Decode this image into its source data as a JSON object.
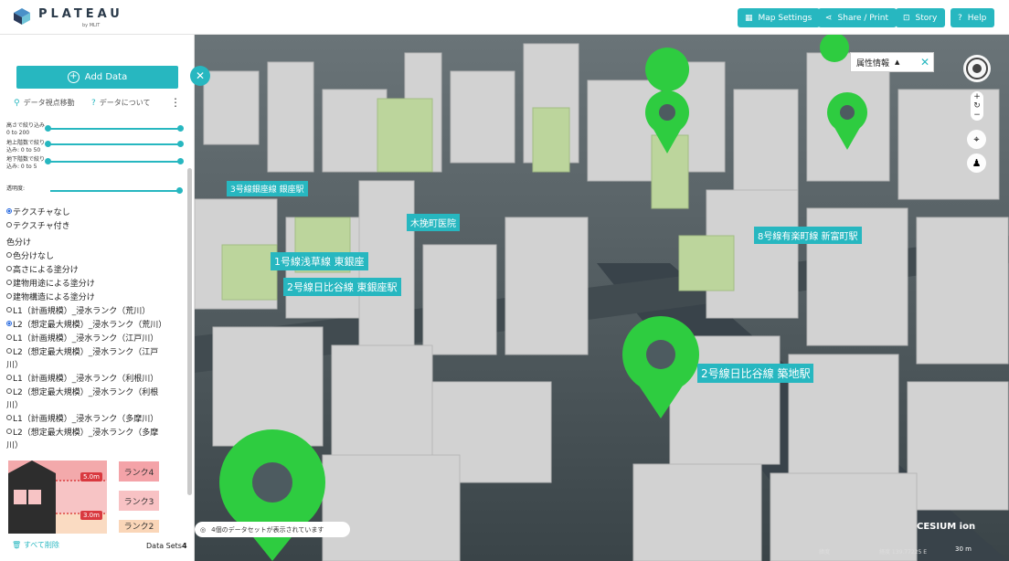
{
  "header": {
    "logo_text": "PLATEAU",
    "logo_sub": "by MLIT",
    "buttons": [
      {
        "label": "Map Settings",
        "icon": "map-icon"
      },
      {
        "label": "Share / Print",
        "icon": "share-icon"
      },
      {
        "label": "Story",
        "icon": "story-icon"
      },
      {
        "label": "Help",
        "icon": "help-icon"
      }
    ]
  },
  "sidebar": {
    "add_data_label": "Add Data",
    "link_move": "データ視点移動",
    "link_about": "データについて",
    "sliders": [
      {
        "label_line1": "高さで絞り込み",
        "label_line2": "0 to 200"
      },
      {
        "label_line1": "地上階数で絞り",
        "label_line2": "込み: 0 to 50"
      },
      {
        "label_line1": "地下階数で絞り",
        "label_line2": "込み: 0 to 5"
      }
    ],
    "opacity_label": "透明度:",
    "texture_options": [
      {
        "label": "テクスチャなし",
        "selected": true
      },
      {
        "label": "テクスチャ付き",
        "selected": false
      }
    ],
    "color_heading": "色分け",
    "color_options": [
      {
        "label": "色分けなし",
        "selected": false
      },
      {
        "label": "高さによる塗分け",
        "selected": false
      },
      {
        "label": "建物用途による塗分け",
        "selected": false
      },
      {
        "label": "建物構造による塗分け",
        "selected": false
      },
      {
        "label": "L1（計画規模）_浸水ランク（荒川）",
        "selected": false
      },
      {
        "label": "L2（想定最大規模）_浸水ランク（荒川）",
        "selected": true
      },
      {
        "label": "L1（計画規模）_浸水ランク（江戸川）",
        "selected": false
      },
      {
        "label": "L2（想定最大規模）_浸水ランク（江戸",
        "label_cont": "川）",
        "selected": false
      },
      {
        "label": "L1（計画規模）_浸水ランク（利根川）",
        "selected": false
      },
      {
        "label": "L2（想定最大規模）_浸水ランク（利根",
        "label_cont": "川）",
        "selected": false
      },
      {
        "label": "L1（計画規模）_浸水ランク（多摩川）",
        "selected": false
      },
      {
        "label": "L2（想定最大規模）_浸水ランク（多摩",
        "label_cont": "川）",
        "selected": false
      }
    ],
    "legend": {
      "depth_labels": [
        "5.0m",
        "3.0m"
      ],
      "ranks": [
        {
          "label": "ランク4",
          "color": "#f4a3a8"
        },
        {
          "label": "ランク3",
          "color": "#f8c2c4"
        },
        {
          "label": "ランク2",
          "color": "#fad6b8"
        }
      ]
    },
    "delete_all": "すべて削除",
    "datasets_label": "Data Sets",
    "datasets_count": "4"
  },
  "map": {
    "info_panel_title": "属性情報",
    "status_text": "4個のデータセットが表示されています",
    "credit_logo": "CESIUM ion",
    "scale_label": "30 m",
    "footer_coords": [
      "緯度",
      "経度 139.77225 E"
    ],
    "labels": [
      {
        "text": "2号線日比谷線 築地駅"
      },
      {
        "text": "8号線有楽町線 新富町駅"
      },
      {
        "text": "2号線日比谷線 東銀座駅"
      },
      {
        "text": "1号線浅草線 東銀座"
      },
      {
        "text": "3号線銀座線 銀座駅"
      },
      {
        "text": "木挽町医院"
      }
    ]
  },
  "colors": {
    "accent": "#27b7c0",
    "pin": "#2ecc40",
    "building": "#cfcfcf",
    "building_green": "#b9d39a",
    "road": "#3e484c"
  }
}
